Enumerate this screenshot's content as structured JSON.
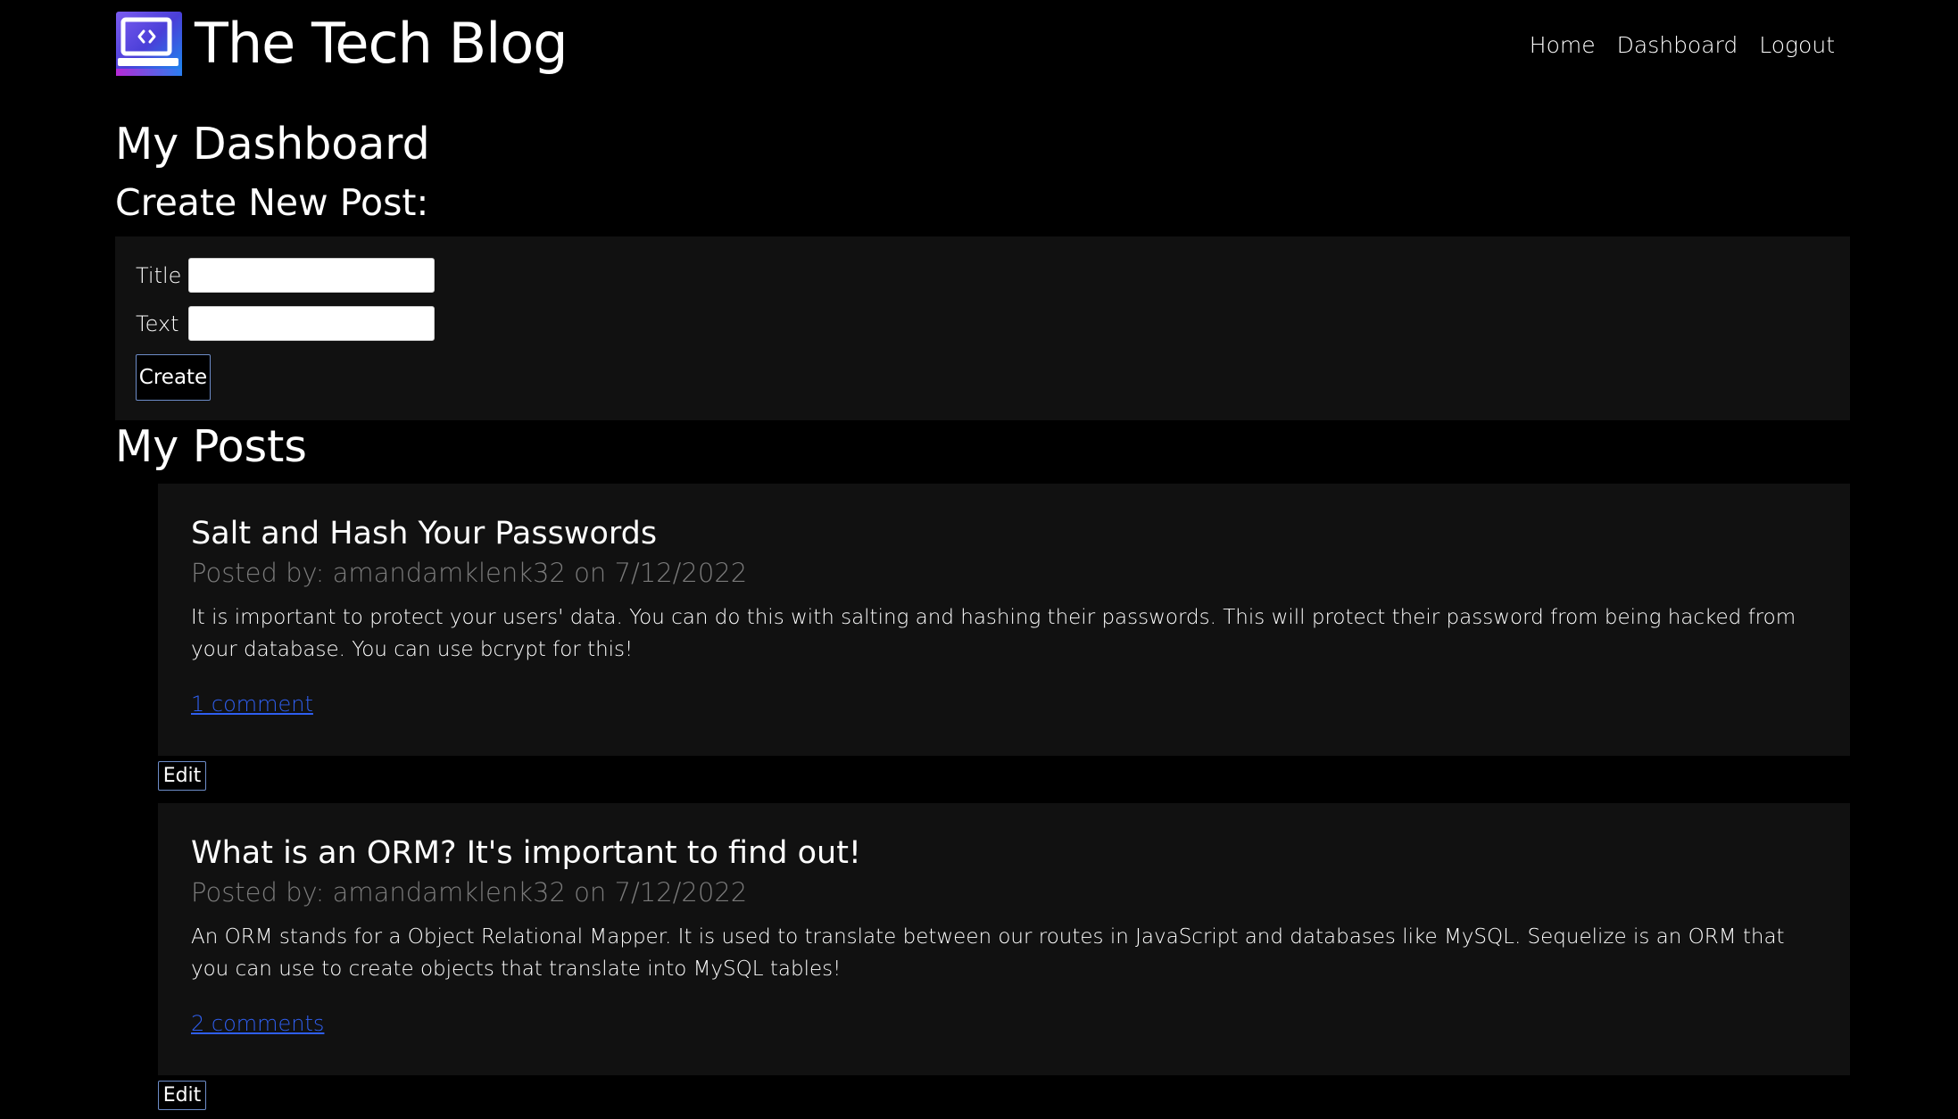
{
  "header": {
    "title": "The Tech Blog",
    "logo_icon": "laptop-code-icon",
    "nav": {
      "home": "Home",
      "dashboard": "Dashboard",
      "logout": "Logout"
    }
  },
  "page": {
    "title": "My Dashboard",
    "create_heading": "Create New Post:"
  },
  "form": {
    "title_label": "Title",
    "title_value": "",
    "text_label": "Text",
    "text_value": "",
    "submit_label": "Create"
  },
  "posts_section": {
    "heading": "My Posts",
    "edit_label": "Edit"
  },
  "posts": [
    {
      "title": "Salt and Hash Your Passwords",
      "meta": "Posted by: amandamklenk32 on 7/12/2022",
      "body": "It is important to protect your users' data. You can do this with salting and hashing their passwords. This will protect their password from being hacked from your database. You can use bcrypt for this!",
      "comments": "1 comment"
    },
    {
      "title": "What is an ORM? It's important to find out!",
      "meta": "Posted by: amandamklenk32 on 7/12/2022",
      "body": "An ORM stands for a Object Relational Mapper. It is used to translate between our routes in JavaScript and databases like MySQL. Sequelize is an ORM that you can use to create objects that translate into MySQL tables!",
      "comments": "2 comments"
    }
  ],
  "colors": {
    "background": "#000000",
    "panel": "#111111",
    "meta_text": "#7b7b7b",
    "link": "#2f5ff0",
    "button_border": "#6d8cc8"
  }
}
